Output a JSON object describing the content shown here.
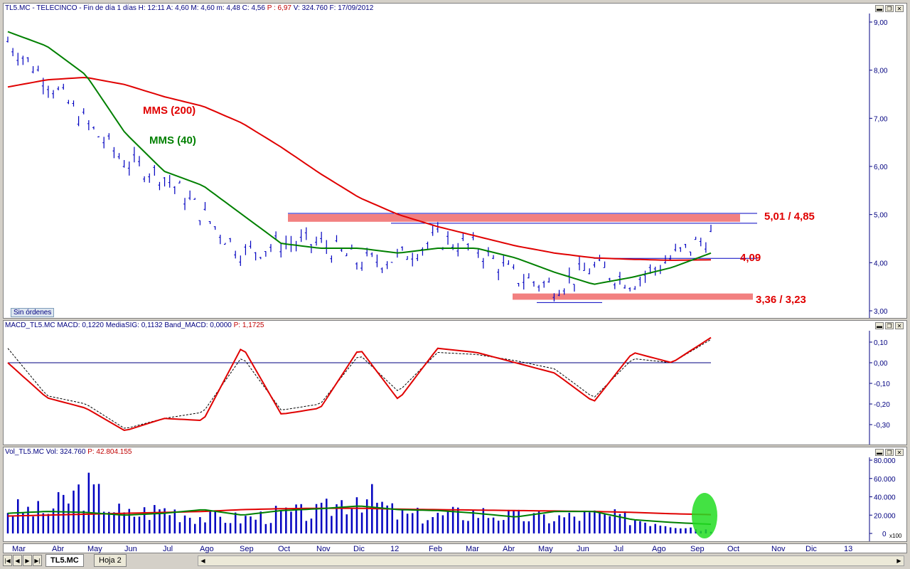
{
  "price_panel": {
    "header": "TL5.MC - TELECINCO - Fin de día 1 días  H: 12:11  A: 4,60  M: 4,60  m: 4,48  C: 4,56  ",
    "header_change": "P : 6,97",
    "header_tail": "  V: 324.760  F: 17/09/2012",
    "label_mms200": "MMS (200)",
    "label_mms40": "MMS (40)",
    "label_resistance": "5,01 / 4,85",
    "label_mid": "4,09",
    "label_support": "3,36 / 3,23",
    "sin_ordenes": "Sin órdenes",
    "y_ticks": [
      "9,00",
      "8,00",
      "7,00",
      "6,00",
      "5,00",
      "4,00",
      "3,00"
    ]
  },
  "macd_panel": {
    "header": "MACD_TL5.MC  MACD: 0,1220  MediaSIG: 0,1132  Band_MACD: 0,0000  ",
    "header_p": "P: 1,1725",
    "y_ticks": [
      "0,10",
      "0,00",
      "-0,10",
      "-0,20",
      "-0,30"
    ]
  },
  "vol_panel": {
    "header": "Vol_TL5.MC  Vol: 324.760  ",
    "header_p": "P: 42.804.155",
    "y_ticks": [
      "80.000",
      "60.000",
      "40.000",
      "20.000",
      "0"
    ],
    "unit": "x100"
  },
  "x_labels": [
    "Mar",
    "Abr",
    "May",
    "Jun",
    "Jul",
    "Ago",
    "Sep",
    "Oct",
    "Nov",
    "Dic",
    "12",
    "Feb",
    "Mar",
    "Abr",
    "May",
    "Jun",
    "Jul",
    "Ago",
    "Sep",
    "Oct",
    "Nov",
    "Dic",
    "13"
  ],
  "tabs": [
    "TL5.MC",
    "Hoja 2"
  ],
  "colors": {
    "price": "#0000c0",
    "mms200": "#e00000",
    "mms40": "#008000",
    "band": "#f28080",
    "highlight": "#22dd22"
  },
  "chart_data": [
    {
      "type": "line",
      "title": "TL5.MC - TELECINCO",
      "ylim": [
        2.9,
        9.25
      ],
      "x": [
        "Mar",
        "Abr",
        "May",
        "Jun",
        "Jul",
        "Ago",
        "Sep",
        "Oct",
        "Nov",
        "Dic",
        "12",
        "Feb",
        "Mar",
        "Abr",
        "May",
        "Jun",
        "Jul",
        "Ago",
        "Sep"
      ],
      "series": [
        {
          "name": "TL5.MC",
          "values": [
            8.6,
            7.8,
            6.9,
            6.1,
            5.8,
            5.0,
            4.2,
            4.4,
            4.4,
            4.0,
            4.1,
            4.5,
            4.3,
            3.7,
            3.5,
            3.9,
            3.6,
            4.1,
            4.56
          ]
        },
        {
          "name": "MMS (200)",
          "values": [
            7.65,
            7.8,
            7.85,
            7.7,
            7.45,
            7.25,
            6.9,
            6.4,
            5.85,
            5.35,
            5.0,
            4.75,
            4.55,
            4.35,
            4.2,
            4.1,
            4.07,
            4.05,
            4.06
          ]
        },
        {
          "name": "MMS (40)",
          "values": [
            8.8,
            8.5,
            7.9,
            6.7,
            5.9,
            5.6,
            5.0,
            4.4,
            4.3,
            4.3,
            4.2,
            4.3,
            4.3,
            4.1,
            3.8,
            3.55,
            3.7,
            3.9,
            4.2
          ]
        }
      ],
      "levels": {
        "resistance": [
          5.01,
          4.85
        ],
        "mid": 4.09,
        "support": [
          3.36,
          3.23
        ]
      }
    },
    {
      "type": "line",
      "title": "MACD_TL5.MC",
      "ylim": [
        -0.4,
        0.15
      ],
      "x": [
        "Mar",
        "Abr",
        "May",
        "Jun",
        "Jul",
        "Ago",
        "Sep",
        "Oct",
        "Nov",
        "Dic",
        "12",
        "Feb",
        "Mar",
        "Abr",
        "May",
        "Jun",
        "Jul",
        "Ago",
        "Sep"
      ],
      "series": [
        {
          "name": "MACD",
          "values": [
            0.0,
            -0.17,
            -0.22,
            -0.33,
            -0.27,
            -0.28,
            0.08,
            -0.25,
            -0.22,
            0.07,
            -0.18,
            0.07,
            0.05,
            0.0,
            -0.05,
            -0.19,
            0.05,
            0.0,
            0.122
          ]
        },
        {
          "name": "MediaSIG",
          "values": [
            0.07,
            -0.16,
            -0.2,
            -0.32,
            -0.27,
            -0.24,
            0.03,
            -0.23,
            -0.2,
            0.04,
            -0.14,
            0.05,
            0.04,
            0.01,
            -0.03,
            -0.17,
            0.02,
            0.0,
            0.113
          ]
        }
      ]
    },
    {
      "type": "bar",
      "title": "Vol_TL5.MC",
      "ylim": [
        0,
        85000
      ],
      "unit": "x100",
      "highlight": "last",
      "series": [
        {
          "name": "Vol",
          "values": [
            30000,
            26000,
            55000,
            22000,
            30000,
            20000,
            18000,
            24000,
            25000,
            50000,
            22000,
            21000,
            26000,
            20000,
            19000,
            22000,
            18000,
            12000,
            3247.6
          ]
        },
        {
          "name": "MA short",
          "values": [
            22000,
            24000,
            23000,
            20000,
            22000,
            26000,
            20000,
            25000,
            27000,
            30000,
            26000,
            25000,
            22000,
            18000,
            24000,
            24000,
            15000,
            12000,
            10000
          ]
        },
        {
          "name": "MA long",
          "values": [
            19000,
            20000,
            21000,
            22000,
            23000,
            24000,
            26000,
            27000,
            27500,
            27500,
            26500,
            26000,
            25500,
            25000,
            24500,
            24000,
            23000,
            21500,
            20500
          ]
        }
      ]
    }
  ]
}
